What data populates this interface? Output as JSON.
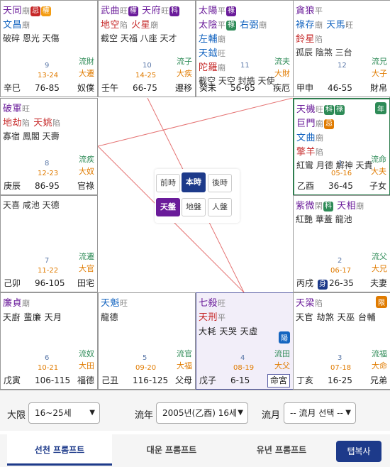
{
  "colors": {
    "purple": "#6a1b9a",
    "red": "#c62828",
    "blue": "#1565c0",
    "black": "#222222",
    "green": "#2e8b57",
    "orange": "#e07b00"
  },
  "cells": [
    {
      "stars": [
        [
          {
            "t": "天同",
            "c": "purple",
            "s": "廟",
            "b": [
              [
                "忌",
                "#c62828"
              ],
              [
                "權",
                "#f39c12"
              ]
            ]
          }
        ],
        [
          {
            "t": "文昌",
            "c": "blue",
            "s": "廟"
          }
        ]
      ],
      "minor": "破碎 恩光 天傷",
      "flow": [
        "流財",
        "大遷"
      ],
      "num": "9",
      "ages": "13-24",
      "gz": "辛巳",
      "age": "76-85",
      "pal": "奴僕"
    },
    {
      "stars": [
        [
          {
            "t": "武曲",
            "c": "purple",
            "s": "旺",
            "b": [
              [
                "權",
                "#6a1b9a"
              ]
            ]
          },
          {
            "t": "天府",
            "c": "purple",
            "s": "旺",
            "b": [
              [
                "科",
                "#6a1b9a"
              ]
            ]
          }
        ],
        [
          {
            "t": "地空",
            "c": "red",
            "s": "陷"
          },
          {
            "t": "火星",
            "c": "red",
            "s": "廟"
          }
        ]
      ],
      "minor": "截空 天福 八座 天才",
      "flow": [
        "流子",
        "大疾"
      ],
      "num": "10",
      "ages": "14-25",
      "gz": "壬午",
      "age": "66-75",
      "pal": "遷移"
    },
    {
      "stars": [
        [
          {
            "t": "太陽",
            "c": "purple",
            "s": "平",
            "b": [
              [
                "祿",
                "#6a1b9a"
              ]
            ]
          }
        ],
        [
          {
            "t": "太陰",
            "c": "purple",
            "s": "平",
            "b": [
              [
                "祿",
                "#2e8b57"
              ]
            ]
          },
          {
            "t": "右弼",
            "c": "blue",
            "s": "廟"
          }
        ],
        [
          {
            "t": "左輔",
            "c": "blue",
            "s": "廟"
          }
        ],
        [
          {
            "t": "天鉞",
            "c": "blue",
            "s": "旺"
          }
        ],
        [
          {
            "t": "陀羅",
            "c": "red",
            "s": "廟"
          }
        ]
      ],
      "minor": "截空 天空 封誥 天使",
      "flow": [
        "流夫",
        "大財"
      ],
      "num": "11",
      "ages": "",
      "gz": "癸未",
      "age": "56-65",
      "pal": "疾厄"
    },
    {
      "stars": [
        [
          {
            "t": "貪狼",
            "c": "purple",
            "s": "平"
          }
        ],
        [
          {
            "t": "祿存",
            "c": "blue",
            "s": "廟"
          },
          {
            "t": "天馬",
            "c": "blue",
            "s": "旺"
          }
        ],
        [
          {
            "t": "鈴星",
            "c": "red",
            "s": "陷"
          }
        ]
      ],
      "minor": "孤辰 陰煞 三台",
      "flow": [
        "流兄",
        "大子"
      ],
      "num": "12",
      "ages": "",
      "gz": "甲申",
      "age": "46-55",
      "pal": "財帛"
    },
    {
      "stars": [
        [
          {
            "t": "破軍",
            "c": "purple",
            "s": "旺"
          }
        ],
        [
          {
            "t": "地劫",
            "c": "red",
            "s": "陷"
          },
          {
            "t": "天姚",
            "c": "red",
            "s": "陷"
          }
        ]
      ],
      "minor": "寡宿 鳳閣 天壽",
      "flow": [
        "流疾",
        "大奴"
      ],
      "num": "8",
      "ages": "12-23",
      "gz": "庚辰",
      "age": "86-95",
      "pal": "官祿"
    },
    {
      "stars": [
        [
          {
            "t": "天機",
            "c": "purple",
            "s": "旺",
            "b": [
              [
                "科",
                "#2e8b57"
              ],
              [
                "祿",
                "#2e8b57"
              ]
            ]
          }
        ],
        [
          {
            "t": "巨門",
            "c": "purple",
            "s": "廟",
            "b": [
              [
                "忌",
                "#e07b00"
              ]
            ]
          }
        ],
        [
          {
            "t": "文曲",
            "c": "blue",
            "s": "廟"
          }
        ],
        [
          {
            "t": "擎羊",
            "c": "red",
            "s": "陷"
          }
        ]
      ],
      "minor": "紅鸞 月德 解神 天貴",
      "flow": [
        "流命",
        "大夫"
      ],
      "num": "1",
      "ages": "05-16",
      "gz": "乙酉",
      "age": "36-45",
      "pal": "子女",
      "corner": [
        "年",
        "#2e8b57"
      ]
    },
    {
      "stars": [],
      "minor": "天喜 咸池 天德",
      "flow": [
        "流遷",
        "大官"
      ],
      "num": "7",
      "ages": "11-22",
      "gz": "己卯",
      "age": "96-105",
      "pal": "田宅"
    },
    {
      "stars": [
        [
          {
            "t": "紫微",
            "c": "purple",
            "s": "閑",
            "b": [
              [
                "科",
                "#2e8b57"
              ]
            ]
          },
          {
            "t": "天相",
            "c": "purple",
            "s": "廟"
          }
        ]
      ],
      "minor": "紅艷 華蓋 龍池",
      "flow": [
        "流父",
        "大兄"
      ],
      "num": "2",
      "ages": "06-17",
      "gz": "丙戌",
      "age": "26-35",
      "pal": "夫妻",
      "shen": "身"
    },
    {
      "stars": [
        [
          {
            "t": "廉貞",
            "c": "purple",
            "s": "廟"
          }
        ],
        [
          {
            "t": "天廚 蜚廉 天月",
            "c": "black",
            "s": ""
          }
        ]
      ],
      "minor": "",
      "flow": [
        "流奴",
        "大田"
      ],
      "num": "6",
      "ages": "10-21",
      "gz": "戊寅",
      "age": "106-115",
      "pal": "福德"
    },
    {
      "stars": [
        [
          {
            "t": "天魁",
            "c": "blue",
            "s": "旺"
          }
        ],
        [
          {
            "t": "龍德",
            "c": "black",
            "s": ""
          }
        ]
      ],
      "minor": "",
      "flow": [
        "流官",
        "大福"
      ],
      "num": "5",
      "ages": "09-20",
      "gz": "己丑",
      "age": "116-125",
      "pal": "父母"
    },
    {
      "stars": [
        [
          {
            "t": "七殺",
            "c": "purple",
            "s": "旺"
          }
        ],
        [
          {
            "t": "天刑",
            "c": "red",
            "s": "平"
          }
        ],
        [
          {
            "t": "大耗 天哭 天虛",
            "c": "black",
            "s": ""
          }
        ]
      ],
      "minor": "",
      "flow": [
        "流田",
        "大父"
      ],
      "num": "4",
      "ages": "08-19",
      "gz": "戊子",
      "age": "6-15",
      "pal": "命宮",
      "corner": [
        "陽",
        "#1565c0"
      ]
    },
    {
      "stars": [
        [
          {
            "t": "天梁",
            "c": "purple",
            "s": "陷"
          }
        ],
        [
          {
            "t": "天官 劫煞 天巫 台輔",
            "c": "black",
            "s": ""
          }
        ]
      ],
      "minor": "",
      "flow": [
        "流福",
        "大命"
      ],
      "num": "3",
      "ages": "07-18",
      "gz": "丁亥",
      "age": "16-25",
      "pal": "兄弟",
      "corner": [
        "限",
        "#e07b00"
      ]
    }
  ],
  "center": {
    "row1": [
      "前時",
      "本時",
      "後時"
    ],
    "row2": [
      "天盤",
      "地盤",
      "人盤"
    ]
  },
  "controls": {
    "daehan_label": "大限",
    "daehan_value": "16~25세",
    "year_label": "流年",
    "year_value": "2005년(乙酉) 16세",
    "month_label": "流月",
    "month_value": "-- 流月 선택 --"
  },
  "tabs": [
    "선천 프롬프트",
    "대운 프롬프트",
    "유년 프롬프트"
  ],
  "copy_label": "탭복사"
}
